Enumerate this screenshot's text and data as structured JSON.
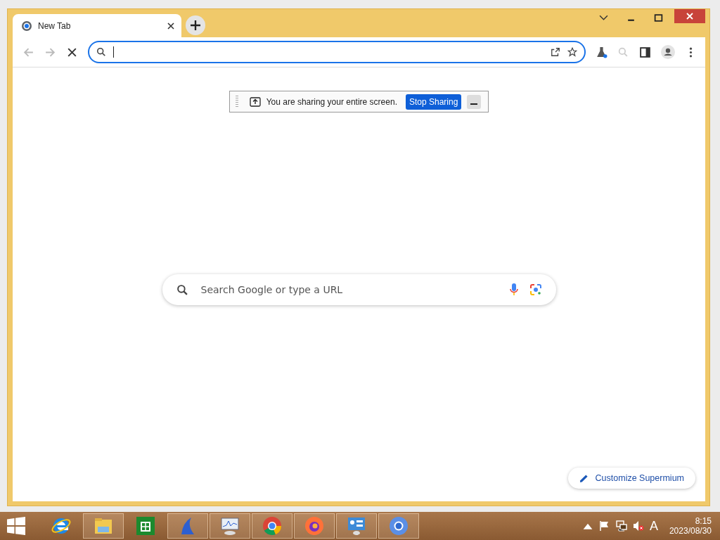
{
  "browser": {
    "tabs": [
      {
        "title": "New Tab",
        "selected": true
      }
    ],
    "share_bar": {
      "message": "You are sharing your entire screen.",
      "button": "Stop Sharing"
    },
    "search": {
      "placeholder": "Search Google or type a URL"
    },
    "customize_button": "Customize Supermium"
  },
  "taskbar": {
    "apps": [
      {
        "kind": "ie",
        "running": false
      },
      {
        "kind": "explorer",
        "running": true
      },
      {
        "kind": "store",
        "running": false
      },
      {
        "kind": "shark",
        "running": true
      },
      {
        "kind": "monitor",
        "running": true
      },
      {
        "kind": "chrome",
        "running": true
      },
      {
        "kind": "firefox",
        "running": true
      },
      {
        "kind": "panel",
        "running": true
      },
      {
        "kind": "chromium",
        "running": true
      }
    ],
    "tray": {
      "ime": "A",
      "time": "8:15",
      "date": "2023/08/30"
    }
  }
}
